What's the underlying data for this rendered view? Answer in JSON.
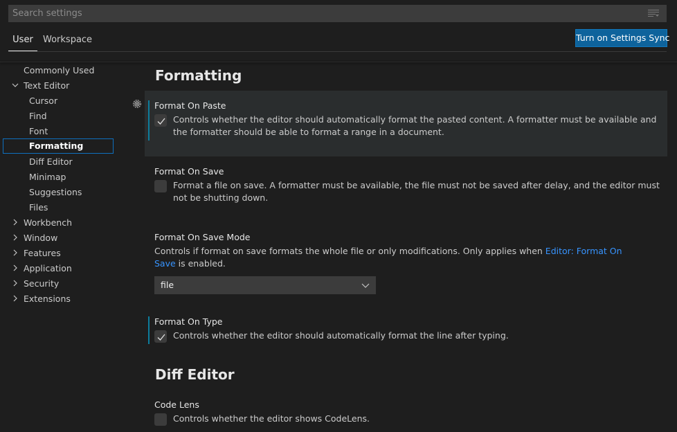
{
  "search": {
    "placeholder": "Search settings"
  },
  "tabs": [
    {
      "label": "User"
    },
    {
      "label": "Workspace"
    }
  ],
  "sync_button_label": "Turn on Settings Sync",
  "toc": {
    "items": [
      {
        "label": "Commonly Used"
      },
      {
        "label": "Text Editor"
      },
      {
        "label": "Cursor"
      },
      {
        "label": "Find"
      },
      {
        "label": "Font"
      },
      {
        "label": "Formatting"
      },
      {
        "label": "Diff Editor"
      },
      {
        "label": "Minimap"
      },
      {
        "label": "Suggestions"
      },
      {
        "label": "Files"
      },
      {
        "label": "Workbench"
      },
      {
        "label": "Window"
      },
      {
        "label": "Features"
      },
      {
        "label": "Application"
      },
      {
        "label": "Security"
      },
      {
        "label": "Extensions"
      }
    ]
  },
  "sections": {
    "formatting_title": "Formatting",
    "diff_editor_title": "Diff Editor"
  },
  "settings": {
    "format_on_paste": {
      "title": "Format On Paste",
      "desc": "Controls whether the editor should automatically format the pasted content. A formatter must be available and the formatter should be able to format a range in a document.",
      "checked": true
    },
    "format_on_save": {
      "title": "Format On Save",
      "desc": "Format a file on save. A formatter must be available, the file must not be saved after delay, and the editor must not be shutting down.",
      "checked": false
    },
    "format_on_save_mode": {
      "title": "Format On Save Mode",
      "desc_before": "Controls if format on save formats the whole file or only modifications. Only applies when ",
      "desc_link": "Editor: Format On Save",
      "desc_after": " is enabled.",
      "value": "file"
    },
    "format_on_type": {
      "title": "Format On Type",
      "desc": "Controls whether the editor should automatically format the line after typing.",
      "checked": true
    },
    "code_lens": {
      "title": "Code Lens",
      "desc": "Controls whether the editor shows CodeLens.",
      "checked": false
    }
  },
  "colors": {
    "accent": "#0e639c",
    "selection_border": "#0e70c0",
    "modified_indicator": "#0c7d9d",
    "link": "#3794ff"
  }
}
